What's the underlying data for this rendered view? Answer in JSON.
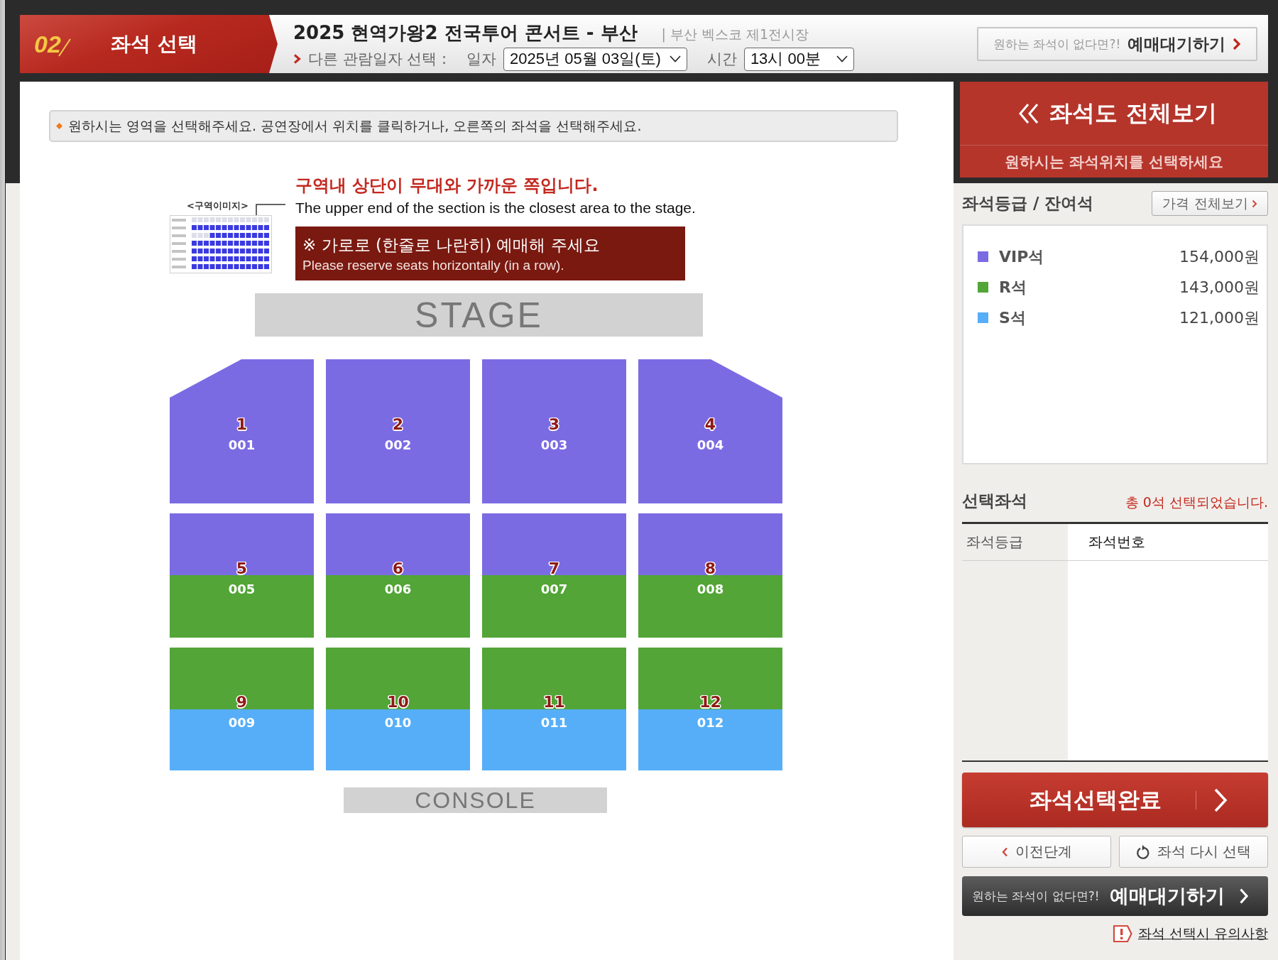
{
  "header": {
    "step": {
      "number": "02",
      "title": "좌석 선택"
    },
    "title": "2025 현역가왕2 전국투어 콘서트 - 부산",
    "venue": "| 부산 벡스코 제1전시장",
    "date_picker": {
      "label": "다른 관람일자 선택 :",
      "date_label": "일자",
      "date_value": "2025년 05월 03일(토)",
      "time_label": "시간",
      "time_value": "13시 00분"
    },
    "waitlist_button": {
      "prompt": "원하는 좌석이 없다면?!",
      "label": "예매대기하기"
    }
  },
  "seat_map": {
    "instruction": "원하시는 영역을 선택해주세요. 공연장에서 위치를 클릭하거나, 오른쪽의 좌석을 선택해주세요.",
    "section_image_label": "<구역이미지>",
    "orientation_note": "구역내 상단이 무대와 가까운 쪽입니다.",
    "orientation_note_en": "The upper end of the section is the closest area to the stage.",
    "reserve_notice": "※ 가로로 (한줄로 나란히) 예매해 주세요",
    "reserve_notice_en": "Please reserve seats horizontally (in a row).",
    "stage": "STAGE",
    "console": "CONSOLE",
    "sections": [
      {
        "number": "1",
        "code": "001",
        "kind": "leftcut",
        "zones": [
          {
            "color": "#7b6be3"
          }
        ]
      },
      {
        "number": "2",
        "code": "002",
        "kind": "block",
        "zones": [
          {
            "color": "#7b6be3"
          }
        ]
      },
      {
        "number": "3",
        "code": "003",
        "kind": "block",
        "zones": [
          {
            "color": "#7b6be3"
          }
        ]
      },
      {
        "number": "4",
        "code": "004",
        "kind": "rightcut",
        "zones": [
          {
            "color": "#7b6be3"
          }
        ]
      },
      {
        "number": "5",
        "code": "005",
        "kind": "block",
        "zones": [
          {
            "color": "#7b6be3"
          },
          {
            "color": "#52a536"
          }
        ]
      },
      {
        "number": "6",
        "code": "006",
        "kind": "block",
        "zones": [
          {
            "color": "#7b6be3"
          },
          {
            "color": "#52a536"
          }
        ]
      },
      {
        "number": "7",
        "code": "007",
        "kind": "block",
        "zones": [
          {
            "color": "#7b6be3"
          },
          {
            "color": "#52a536"
          }
        ]
      },
      {
        "number": "8",
        "code": "008",
        "kind": "block",
        "zones": [
          {
            "color": "#7b6be3"
          },
          {
            "color": "#52a536"
          }
        ]
      },
      {
        "number": "9",
        "code": "009",
        "kind": "block",
        "zones": [
          {
            "color": "#52a536"
          },
          {
            "color": "#56aef8"
          }
        ]
      },
      {
        "number": "10",
        "code": "010",
        "kind": "block",
        "zones": [
          {
            "color": "#52a536"
          },
          {
            "color": "#56aef8"
          }
        ]
      },
      {
        "number": "11",
        "code": "011",
        "kind": "block",
        "zones": [
          {
            "color": "#52a536"
          },
          {
            "color": "#56aef8"
          }
        ]
      },
      {
        "number": "12",
        "code": "012",
        "kind": "block",
        "zones": [
          {
            "color": "#52a536"
          },
          {
            "color": "#56aef8"
          }
        ]
      }
    ]
  },
  "sidebar": {
    "overview": {
      "label": "좌석도 전체보기",
      "hint": "원하시는 좌석위치를 선택하세요"
    },
    "grades": {
      "title": "좌석등급 / 잔여석",
      "price_button": "가격 전체보기",
      "items": [
        {
          "name": "VIP석",
          "price": "154,000원",
          "color": "#7b6be3"
        },
        {
          "name": "R석",
          "price": "143,000원",
          "color": "#52a536"
        },
        {
          "name": "S석",
          "price": "121,000원",
          "color": "#56aef8"
        }
      ]
    },
    "selected": {
      "title": "선택좌석",
      "summary": "총 0석 선택되었습니다.",
      "columns": [
        "좌석등급",
        "좌석번호"
      ]
    },
    "complete_button": "좌석선택완료",
    "prev_button": "이전단계",
    "reset_button": "좌석 다시 선택",
    "waitlist_button": {
      "prompt": "원하는 좌석이 없다면?!",
      "label": "예매대기하기"
    },
    "notice_link": "좌석 선택시 유의사항"
  }
}
